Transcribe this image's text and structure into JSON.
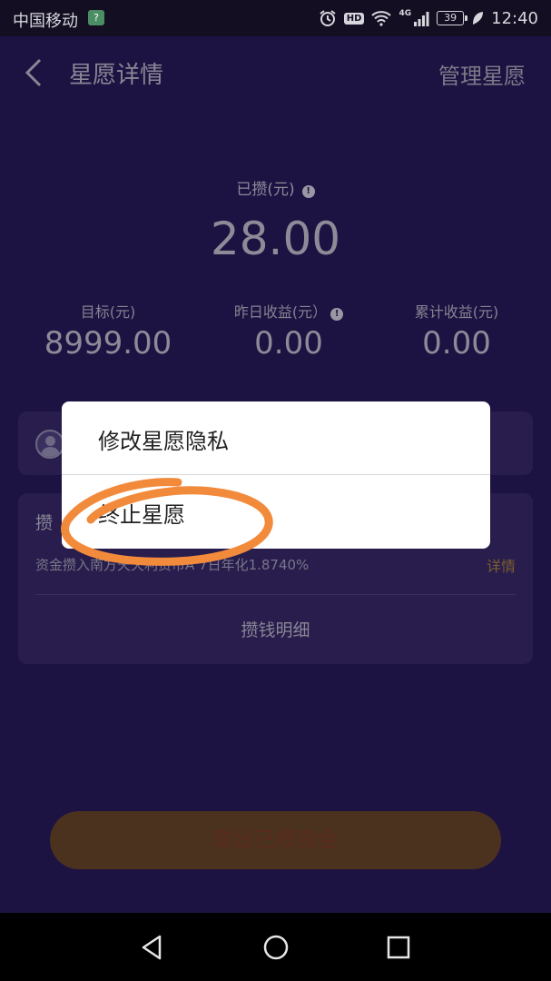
{
  "status_bar": {
    "carrier": "中国移动",
    "hd": "HD",
    "network": "4G",
    "battery": "39",
    "time": "12:40"
  },
  "header": {
    "title": "星愿详情",
    "manage": "管理星愿"
  },
  "summary": {
    "saved_label": "已攒(元)",
    "saved_value": "28.00",
    "target_label": "目标(元)",
    "target_value": "8999.00",
    "yesterday_label": "昨日收益(元）",
    "yesterday_value": "0.00",
    "total_label": "累计收益(元)",
    "total_value": "0.00"
  },
  "savings_card": {
    "title": "攒",
    "fund_text": "资金攒入南方天天利货币A 7日年化1.8740%",
    "detail_label": "详情",
    "history_label": "攒钱明细"
  },
  "withdraw_button": "取出已攒资金",
  "popup_menu": {
    "items": [
      {
        "label": "修改星愿隐私"
      },
      {
        "label": "终止星愿"
      }
    ]
  },
  "annotation": {
    "color": "#f28a3c"
  },
  "colors": {
    "background": "#1d1342",
    "card": "#281d4d",
    "accent": "#7c5f2e"
  }
}
